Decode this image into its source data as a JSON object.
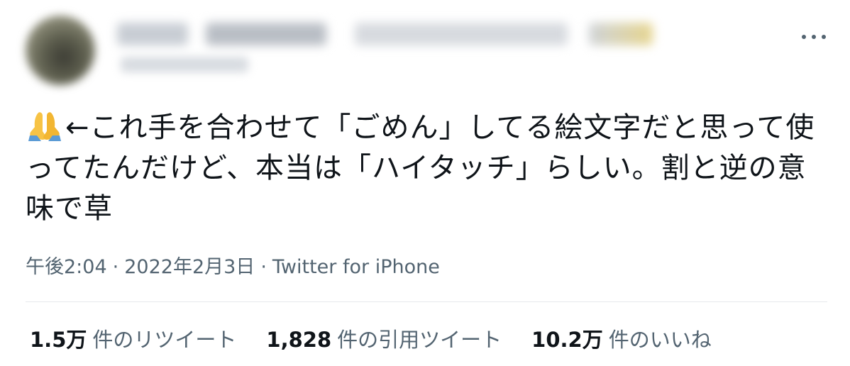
{
  "tweet": {
    "text": "←これ手を合わせて「ごめん」してる絵文字だと思って使ってたんだけど、本当は「ハイタッチ」らしい。割と逆の意味で草",
    "emoji": "folded-hands-icon",
    "time": "午後2:04",
    "date": "2022年2月3日",
    "source": "Twitter for iPhone",
    "separator": "·"
  },
  "stats": {
    "retweets": {
      "count": "1.5万",
      "label": "件のリツイート"
    },
    "quotes": {
      "count": "1,828",
      "label": "件の引用ツイート"
    },
    "likes": {
      "count": "10.2万",
      "label": "件のいいね"
    }
  },
  "colors": {
    "text": "#0f1419",
    "secondary": "#536471",
    "divider": "#e6e9ec"
  }
}
